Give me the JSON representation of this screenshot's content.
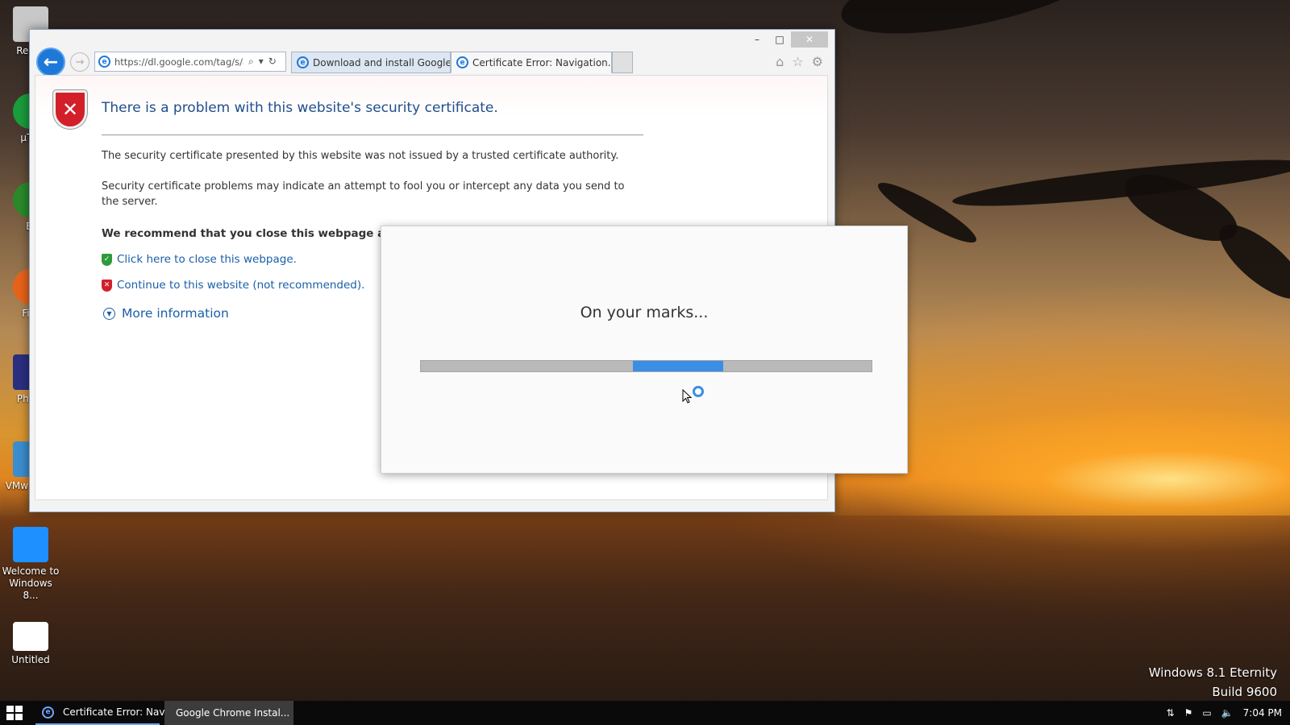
{
  "desktop": {
    "icons": [
      {
        "label": "Recyc",
        "color": "#c8c8c8"
      },
      {
        "label": "µTor",
        "color": "#1a9d3c"
      },
      {
        "label": "Bl",
        "color": "#2a8a2a"
      },
      {
        "label": "Fire",
        "color": "#e8631a"
      },
      {
        "label": "Photo",
        "color": "#2b2f80"
      },
      {
        "label": "VMw Work",
        "color": "#3b8ed0"
      },
      {
        "label": "Welcome to Windows 8...",
        "color": "#1e90ff"
      },
      {
        "label": "Untitled",
        "color": "#ffffff"
      }
    ],
    "os_edition": "Windows 8.1 Eternity",
    "os_build": "Build 9600"
  },
  "browser": {
    "window_controls": {
      "minimize": "–",
      "maximize": "□",
      "close": "✕"
    },
    "address": "https://dl.google.com/tag/s/a",
    "tabs": [
      {
        "label": "Download and install Google C...",
        "active": false
      },
      {
        "label": "Certificate Error: Navigation...",
        "active": true
      }
    ],
    "page": {
      "title": "There is a problem with this website's security certificate.",
      "para1": "The security certificate presented by this website was not issued by a trusted certificate authority.",
      "para2": "Security certificate problems may indicate an attempt to fool you or intercept any data you send to the server.",
      "recommend": "We recommend that you close this webpage and do",
      "close_link": "Click here to close this webpage.",
      "continue_link": "Continue to this website (not recommended).",
      "more_info": "More information"
    }
  },
  "installer": {
    "message": "On your marks...",
    "progress_start": 0.47,
    "progress_end": 0.67,
    "accent": "#3a8ee6"
  },
  "taskbar": {
    "items": [
      {
        "label": "Certificate Error: Navi...",
        "icon": "ie-icon"
      },
      {
        "label": "Google Chrome Instal...",
        "icon": "installer-icon"
      }
    ],
    "clock": "7:04 PM"
  }
}
